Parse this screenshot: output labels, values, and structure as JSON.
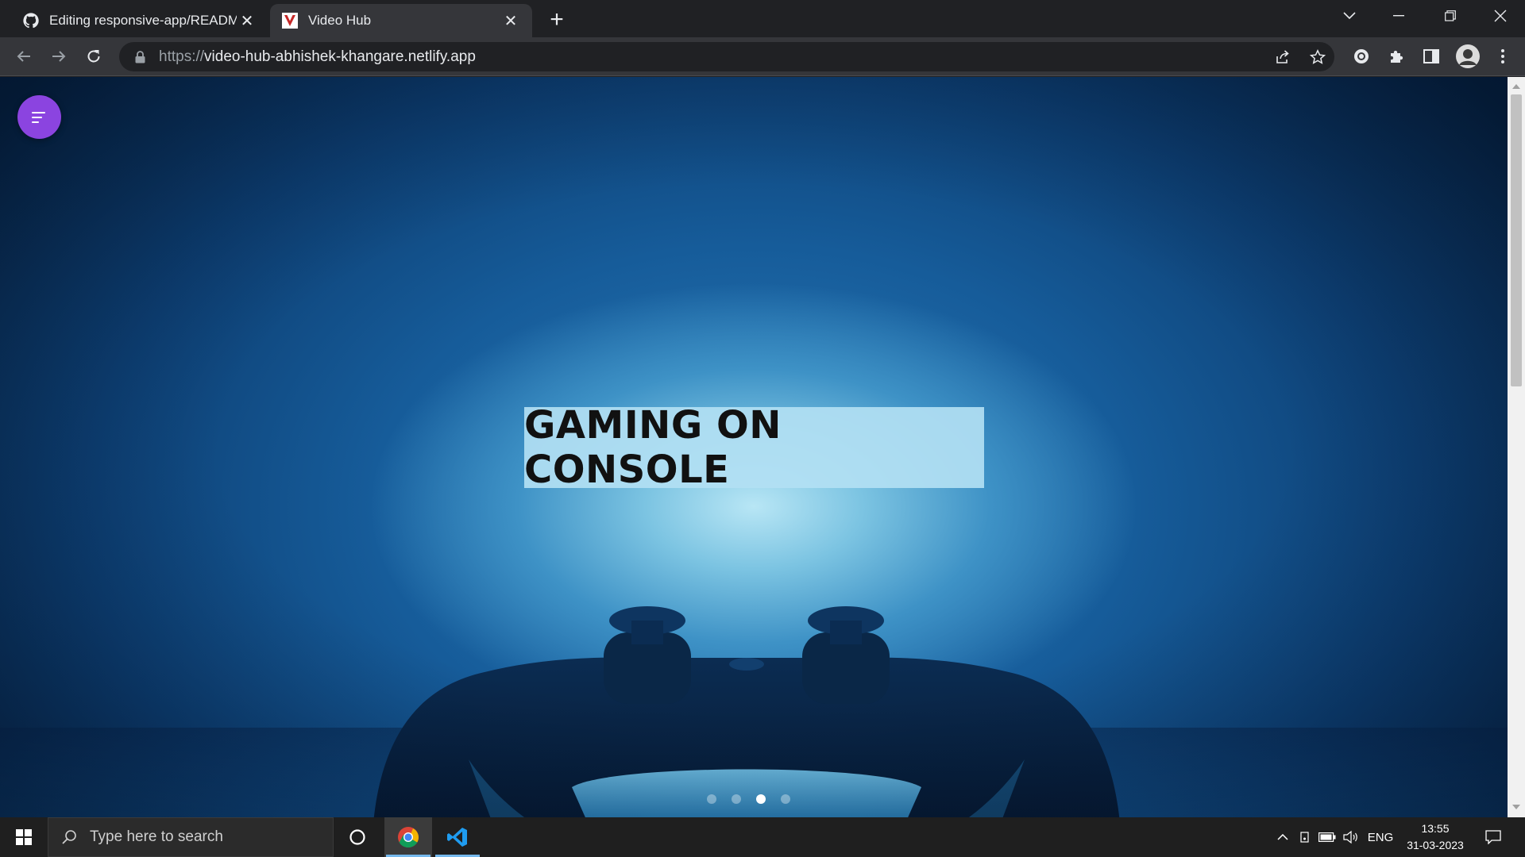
{
  "browser": {
    "tabs": [
      {
        "title": "Editing responsive-app/README",
        "favicon": "github-icon",
        "active": false
      },
      {
        "title": "Video Hub",
        "favicon": "video-hub-v-icon",
        "active": true
      }
    ],
    "url_scheme": "https://",
    "url_host": "video-hub-abhishek-khangare.netlify.app",
    "colors": {
      "chrome_dark": "#202124",
      "toolbar": "#35363a"
    }
  },
  "page": {
    "hero_caption": "GAMING ON CONSOLE",
    "menu_fab_color": "#8b44e0",
    "carousel": {
      "slide_count": 4,
      "active_index": 2
    }
  },
  "taskbar": {
    "search_placeholder": "Type here to search",
    "language": "ENG",
    "time": "13:55",
    "date": "31-03-2023",
    "apps": [
      "chrome-icon",
      "vscode-icon"
    ]
  }
}
